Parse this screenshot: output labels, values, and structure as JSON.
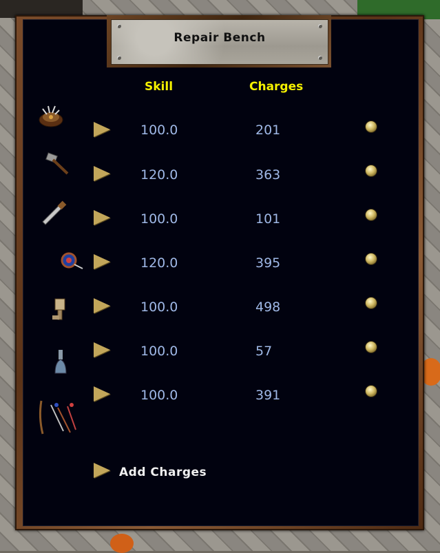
{
  "window": {
    "title": "Repair Bench"
  },
  "headers": {
    "skill": "Skill",
    "charges": "Charges"
  },
  "rows": [
    {
      "icon": "ship-wheel-icon",
      "skill": "100.0",
      "charges": "201"
    },
    {
      "icon": "smith-hammer-icon",
      "skill": "120.0",
      "charges": "363"
    },
    {
      "icon": "saw-icon",
      "skill": "100.0",
      "charges": "101"
    },
    {
      "icon": "sewing-kit-icon",
      "skill": "120.0",
      "charges": "395"
    },
    {
      "icon": "tinker-tools-icon",
      "skill": "100.0",
      "charges": "498"
    },
    {
      "icon": "flask-icon",
      "skill": "100.0",
      "charges": "57"
    },
    {
      "icon": "bow-arrows-icon",
      "skill": "100.0",
      "charges": "391"
    }
  ],
  "footer": {
    "add_label": "Add Charges"
  },
  "colors": {
    "header": "#f4f000",
    "value": "#9fb8e6",
    "panel": "#01020f",
    "frame": "#6b4323"
  }
}
